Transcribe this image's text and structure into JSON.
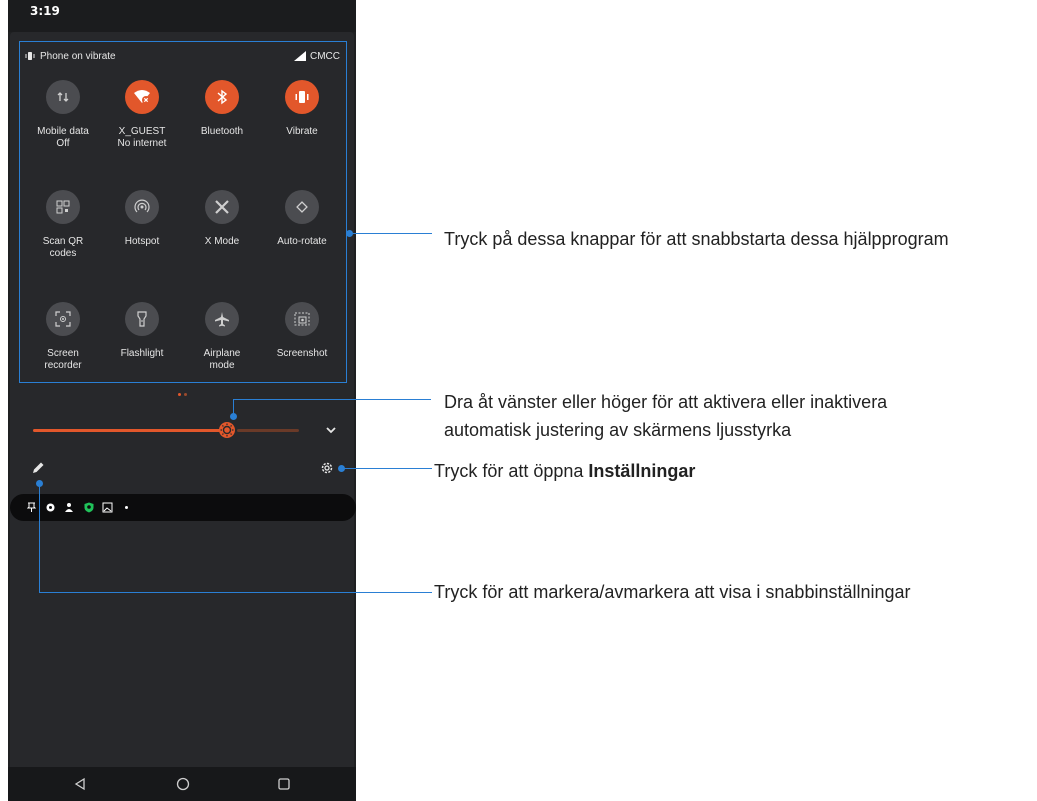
{
  "status_bar": {
    "time": "3:19"
  },
  "quick_settings": {
    "vibrate_status": "Phone on vibrate",
    "carrier": "CMCC",
    "tiles": [
      {
        "label": "Mobile data",
        "sub": "Off",
        "icon": "mobile-data-icon",
        "state": "off"
      },
      {
        "label": "X_GUEST",
        "sub": "No internet",
        "icon": "wifi-icon",
        "state": "on"
      },
      {
        "label": "Bluetooth",
        "sub": "",
        "icon": "bluetooth-icon",
        "state": "on"
      },
      {
        "label": "Vibrate",
        "sub": "",
        "icon": "vibrate-icon",
        "state": "on"
      },
      {
        "label": "Scan QR",
        "sub": "codes",
        "icon": "qr-code-icon",
        "state": "off"
      },
      {
        "label": "Hotspot",
        "sub": "",
        "icon": "hotspot-icon",
        "state": "off"
      },
      {
        "label": "X Mode",
        "sub": "",
        "icon": "x-mode-icon",
        "state": "off"
      },
      {
        "label": "Auto-rotate",
        "sub": "",
        "icon": "auto-rotate-icon",
        "state": "off"
      },
      {
        "label": "Screen",
        "sub": "recorder",
        "icon": "screen-recorder-icon",
        "state": "off"
      },
      {
        "label": "Flashlight",
        "sub": "",
        "icon": "flashlight-icon",
        "state": "off"
      },
      {
        "label": "Airplane",
        "sub": "mode",
        "icon": "airplane-icon",
        "state": "off"
      },
      {
        "label": "Screenshot",
        "sub": "",
        "icon": "screenshot-icon",
        "state": "off"
      }
    ],
    "page_count": 2,
    "active_page": 0,
    "brightness_fraction": 0.73
  },
  "notifications_icons": [
    "pin-icon",
    "gear-icon",
    "person-pin-icon",
    "shield-icon",
    "image-icon",
    "dot-icon"
  ],
  "callouts": {
    "tiles": "Tryck på dessa knappar för att snabbstarta dessa hjälpprogram",
    "brightness_line1": "Dra åt vänster eller höger för att aktivera eller inaktivera",
    "brightness_line2": "automatisk justering av skärmens ljusstyrka",
    "settings_prefix": "Tryck för att öppna ",
    "settings_bold": "Inställningar",
    "edit": "Tryck för att markera/avmarkera att visa i snabbinställningar"
  },
  "colors": {
    "accent": "#e2572b",
    "callout_line": "#2a7fd4",
    "panel": "#27282b"
  }
}
